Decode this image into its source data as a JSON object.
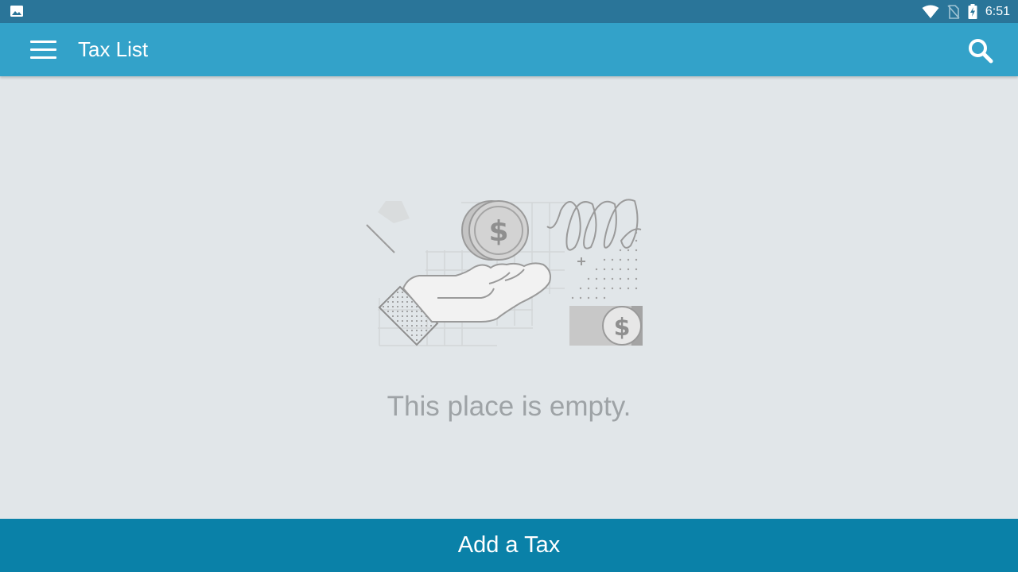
{
  "status_bar": {
    "time": "6:51",
    "left_icon": "image-icon",
    "right_icons": [
      "wifi-icon",
      "no-sim-icon",
      "battery-charging-icon"
    ]
  },
  "app_bar": {
    "title": "Tax List",
    "menu_icon": "menu-icon",
    "search_icon": "search-icon"
  },
  "empty_state": {
    "illustration": "hand-holding-coin-illustration",
    "message": "This place is empty."
  },
  "bottom_action": {
    "label": "Add a Tax"
  },
  "colors": {
    "status_bar": "#2a7599",
    "app_bar": "#33a2c9",
    "background": "#e1e6e9",
    "bottom_button": "#0a81a8",
    "empty_text": "#9ea3a6"
  }
}
